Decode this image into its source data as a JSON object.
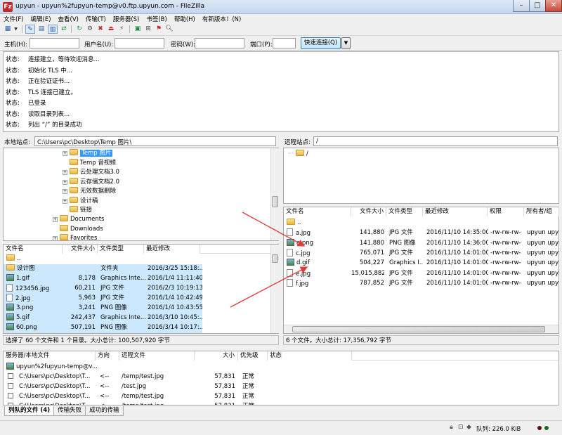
{
  "window": {
    "title": "upyun - upyun%2fupyun-temp@v0.ftp.upyun.com - FileZilla",
    "app_icon": "Fz"
  },
  "menu": [
    "文件(F)",
    "编辑(E)",
    "查看(V)",
    "传输(T)",
    "服务器(S)",
    "书签(B)",
    "帮助(H)",
    "有新版本！(N)"
  ],
  "quickconnect": {
    "host_label": "主机(H):",
    "host_value": "",
    "user_label": "用户名(U):",
    "user_value": "",
    "pass_label": "密码(W):",
    "pass_value": "",
    "port_label": "端口(P):",
    "port_value": "",
    "connect_label": "快速连接(Q)",
    "dropdown_glyph": "▼"
  },
  "log": [
    {
      "k": "状态:",
      "v": "连接建立，等待欢迎消息..."
    },
    {
      "k": "状态:",
      "v": "初始化 TLS 中..."
    },
    {
      "k": "状态:",
      "v": "正在验证证书..."
    },
    {
      "k": "状态:",
      "v": "TLS 连接已建立。"
    },
    {
      "k": "状态:",
      "v": "已登录"
    },
    {
      "k": "状态:",
      "v": "读取目录列表..."
    },
    {
      "k": "状态:",
      "v": "列出 “/” 的目录成功"
    }
  ],
  "local": {
    "site_label": "本地站点:",
    "site_path": "C:\\Users\\pc\\Desktop\\Temp 图片\\",
    "tree": [
      {
        "name": "Temp 图片",
        "selected": true,
        "expander": "+"
      },
      {
        "name": "Temp 音视频",
        "selected": false,
        "expander": ""
      },
      {
        "name": "云处理文档3.0",
        "selected": false,
        "expander": "+"
      },
      {
        "name": "云存储文档2.0",
        "selected": false,
        "expander": "+"
      },
      {
        "name": "无效数据删除",
        "selected": false,
        "expander": "+"
      },
      {
        "name": "设计稿",
        "selected": false,
        "expander": "+"
      },
      {
        "name": "链接",
        "selected": false,
        "expander": ""
      }
    ],
    "tree_roots": [
      {
        "name": "Documents",
        "expander": "+"
      },
      {
        "name": "Downloads",
        "expander": ""
      },
      {
        "name": "Favorites",
        "expander": "+"
      }
    ],
    "columns": [
      "文件名",
      "文件大小",
      "文件类型",
      "最近修改"
    ],
    "files": [
      {
        "name": "..",
        "size": "",
        "type": "",
        "modified": "",
        "icon": "folder"
      },
      {
        "name": "设计图",
        "size": "",
        "type": "文件夹",
        "modified": "2016/3/25 15:18:...",
        "icon": "folder"
      },
      {
        "name": "1.gif",
        "size": "8,178",
        "type": "Graphics Inte...",
        "modified": "2016/1/4 11:11:40",
        "icon": "image"
      },
      {
        "name": "123456.jpg",
        "size": "60,211",
        "type": "JPG 文件",
        "modified": "2016/2/3 10:19:13",
        "icon": "file"
      },
      {
        "name": "2.jpg",
        "size": "5,963",
        "type": "JPG 文件",
        "modified": "2016/1/4 10:42:49",
        "icon": "file"
      },
      {
        "name": "3.png",
        "size": "3,241",
        "type": "PNG 图像",
        "modified": "2016/1/4 10:43:55",
        "icon": "image"
      },
      {
        "name": "5.gif",
        "size": "242,437",
        "type": "Graphics Inte...",
        "modified": "2016/3/10 10:45:...",
        "icon": "image"
      },
      {
        "name": "60.png",
        "size": "507,191",
        "type": "PNG 图像",
        "modified": "2016/3/14 10:17:...",
        "icon": "image"
      }
    ],
    "status": "选择了 60 个文件和 1 个目录。大小总计: 100,507,920 字节"
  },
  "remote": {
    "site_label": "远程站点:",
    "site_path": "/",
    "tree": [
      {
        "name": "/"
      }
    ],
    "columns": [
      "文件名",
      "文件大小",
      "文件类型",
      "最近修改",
      "权限",
      "所有者/组"
    ],
    "files": [
      {
        "name": "..",
        "size": "",
        "type": "",
        "modified": "",
        "perm": "",
        "owner": "",
        "icon": "folder"
      },
      {
        "name": "a.jpg",
        "size": "141,880",
        "type": "JPG 文件",
        "modified": "2016/11/10 14:35:00",
        "perm": "-rw-rw-rw-",
        "owner": "upyun upyun",
        "icon": "file"
      },
      {
        "name": "a.png",
        "size": "141,880",
        "type": "PNG 图像",
        "modified": "2016/11/10 14:36:00",
        "perm": "-rw-rw-rw-",
        "owner": "upyun upyun",
        "icon": "image"
      },
      {
        "name": "c.jpg",
        "size": "765,071",
        "type": "JPG 文件",
        "modified": "2016/11/10 14:01:00",
        "perm": "-rw-rw-rw-",
        "owner": "upyun upyun",
        "icon": "file"
      },
      {
        "name": "d.gif",
        "size": "504,227",
        "type": "Graphics I...",
        "modified": "2016/11/10 14:01:00",
        "perm": "-rw-rw-rw-",
        "owner": "upyun upyun",
        "icon": "image"
      },
      {
        "name": "e.jpg",
        "size": "15,015,882",
        "type": "JPG 文件",
        "modified": "2016/11/10 14:01:00",
        "perm": "-rw-rw-rw-",
        "owner": "upyun upyun",
        "icon": "file"
      },
      {
        "name": "f.jpg",
        "size": "787,852",
        "type": "JPG 文件",
        "modified": "2016/11/10 14:01:00",
        "perm": "-rw-rw-rw-",
        "owner": "upyun upyun",
        "icon": "file"
      }
    ],
    "status": "6 个文件。大小总计: 17,356,792 字节"
  },
  "queue": {
    "columns": [
      "服务器/本地文件",
      "方向",
      "远程文件",
      "大小",
      "优先级",
      "状态"
    ],
    "server_row": "upyun%2fupyun-temp@v...",
    "rows": [
      {
        "local": "C:\\Users\\pc\\Desktop\\T...",
        "dir": "<--",
        "remote": "/temp/test.jpg",
        "size": "57,831",
        "priority": "正常",
        "status": ""
      },
      {
        "local": "C:\\Users\\pc\\Desktop\\T...",
        "dir": "<--",
        "remote": "/test.jpg",
        "size": "57,831",
        "priority": "正常",
        "status": ""
      },
      {
        "local": "C:\\Users\\pc\\Desktop\\T...",
        "dir": "<--",
        "remote": "/temp/test.jpg",
        "size": "57,831",
        "priority": "正常",
        "status": ""
      },
      {
        "local": "C:\\Users\\pc\\Desktop\\T...",
        "dir": "<--",
        "remote": "/temp/test.jpg",
        "size": "57,831",
        "priority": "正常",
        "status": ""
      }
    ],
    "tabs": [
      "列队的文件 (4)",
      "传输失败",
      "成功的传输"
    ],
    "queue_status": "队列: 226.0 KiB"
  },
  "colors": {
    "accent": "#3399ff",
    "arrow": "#e53935",
    "selection": "#cce8ff"
  }
}
